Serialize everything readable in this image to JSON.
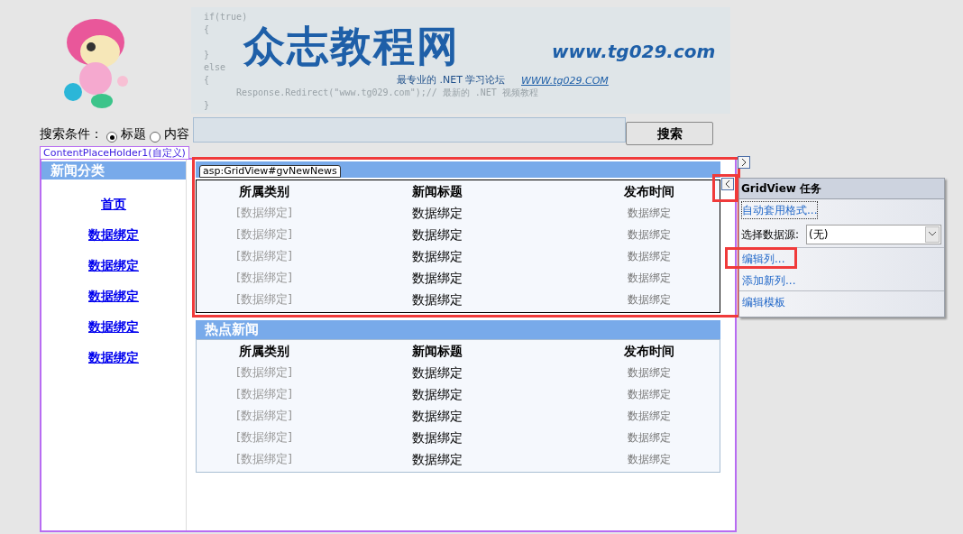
{
  "banner": {
    "code_lines": [
      "if(true)",
      "{",
      "}",
      "else",
      "{",
      "Response.Redirect(\"www.tg029.com\");// 最新的 .NET 视频教程",
      "}"
    ],
    "title": "众志教程网",
    "url": "www.tg029.com",
    "slogan": "最专业的 .NET 学习论坛",
    "small_url": "WWW.tg029.COM"
  },
  "search": {
    "label": "搜索条件：",
    "options": [
      {
        "label": "标题",
        "selected": true
      },
      {
        "label": "内容",
        "selected": false
      }
    ],
    "button": "搜索"
  },
  "placeholder_tag": {
    "name": "ContentPlaceHolder1",
    "mode": "(自定义)"
  },
  "sidebar": {
    "title": "新闻分类",
    "links": [
      "首页",
      "数据绑定",
      "数据绑定",
      "数据绑定",
      "数据绑定",
      "数据绑定"
    ]
  },
  "grids": [
    {
      "designer_tag": "asp:GridView#gvNewNews",
      "highlighted": true,
      "columns": [
        "所属类别",
        "新闻标题",
        "发布时间"
      ],
      "rows": [
        [
          "[数据绑定]",
          "数据绑定",
          "数据绑定"
        ],
        [
          "[数据绑定]",
          "数据绑定",
          "数据绑定"
        ],
        [
          "[数据绑定]",
          "数据绑定",
          "数据绑定"
        ],
        [
          "[数据绑定]",
          "数据绑定",
          "数据绑定"
        ],
        [
          "[数据绑定]",
          "数据绑定",
          "数据绑定"
        ]
      ]
    },
    {
      "title": "热点新闻",
      "highlighted": false,
      "columns": [
        "所属类别",
        "新闻标题",
        "发布时间"
      ],
      "rows": [
        [
          "[数据绑定]",
          "数据绑定",
          "数据绑定"
        ],
        [
          "[数据绑定]",
          "数据绑定",
          "数据绑定"
        ],
        [
          "[数据绑定]",
          "数据绑定",
          "数据绑定"
        ],
        [
          "[数据绑定]",
          "数据绑定",
          "数据绑定"
        ],
        [
          "[数据绑定]",
          "数据绑定",
          "数据绑定"
        ]
      ]
    }
  ],
  "tasks_panel": {
    "title": "GridView 任务",
    "collapse_highlighted": true,
    "items": [
      {
        "kind": "link",
        "label": "自动套用格式...",
        "highlighted": false,
        "focused": true
      },
      {
        "kind": "select",
        "label": "选择数据源:",
        "value": "(无)"
      },
      {
        "kind": "link",
        "label": "编辑列...",
        "highlighted": true,
        "focused": false
      },
      {
        "kind": "link",
        "label": "添加新列...",
        "highlighted": false,
        "focused": false
      },
      {
        "kind": "link",
        "label": "编辑模板",
        "highlighted": false,
        "focused": false
      }
    ]
  }
}
